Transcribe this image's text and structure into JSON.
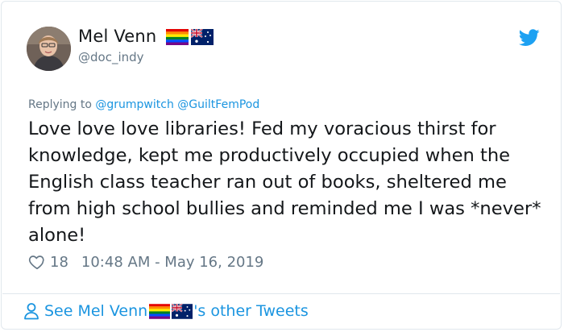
{
  "author": {
    "name": "Mel Venn",
    "handle": "@doc_indy",
    "flag_icons": [
      "rainbow-flag-icon",
      "australia-flag-icon"
    ]
  },
  "reply": {
    "prefix": "Replying to",
    "mentions": [
      "@grumpwitch",
      "@GuiltFemPod"
    ]
  },
  "tweet": {
    "text": "Love love love libraries! Fed my voracious thirst for knowledge, kept me productively occupied when the English class teacher ran out of books, sheltered me from high school bullies and reminded me I was *never* alone!",
    "likes": "18",
    "timestamp": "10:48 AM - May 16, 2019"
  },
  "footer": {
    "prefix": "See Mel Venn",
    "suffix": "'s other Tweets"
  },
  "colors": {
    "link_blue": "#1b95e0",
    "muted_gray": "#657786",
    "text": "#14171a",
    "border": "#e1e8ed"
  }
}
